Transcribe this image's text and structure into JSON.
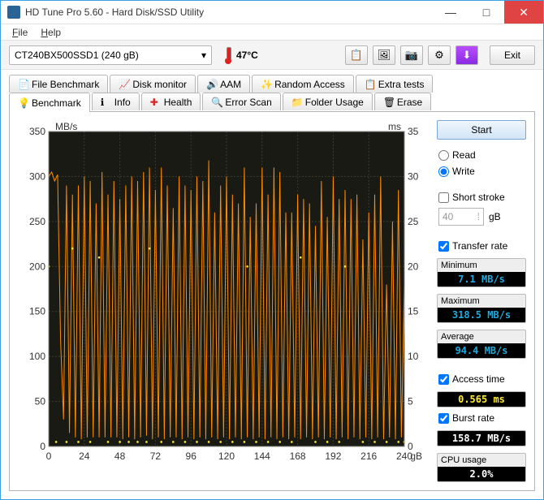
{
  "window": {
    "title": "HD Tune Pro 5.60 - Hard Disk/SSD Utility"
  },
  "menu": {
    "file": "File",
    "help": "Help"
  },
  "toolbar": {
    "drive": "CT240BX500SSD1 (240 gB)",
    "temp": "47°C",
    "exit": "Exit"
  },
  "tabs_top": [
    {
      "label": "File Benchmark"
    },
    {
      "label": "Disk monitor"
    },
    {
      "label": "AAM"
    },
    {
      "label": "Random Access"
    },
    {
      "label": "Extra tests"
    }
  ],
  "tabs_bottom": [
    {
      "label": "Benchmark",
      "active": true
    },
    {
      "label": "Info"
    },
    {
      "label": "Health"
    },
    {
      "label": "Error Scan"
    },
    {
      "label": "Folder Usage"
    },
    {
      "label": "Erase"
    }
  ],
  "side": {
    "start": "Start",
    "read": "Read",
    "write": "Write",
    "short_stroke": "Short stroke",
    "stroke_val": "40",
    "stroke_unit": "gB",
    "transfer_rate": "Transfer rate",
    "minimum_label": "Minimum",
    "minimum_val": "7.1 MB/s",
    "maximum_label": "Maximum",
    "maximum_val": "318.5 MB/s",
    "average_label": "Average",
    "average_val": "94.4 MB/s",
    "access_time": "Access time",
    "access_val": "0.565 ms",
    "burst_rate": "Burst rate",
    "burst_val": "158.7 MB/s",
    "cpu_label": "CPU usage",
    "cpu_val": "2.0%"
  },
  "chart_data": {
    "type": "line",
    "title": "",
    "y_left_label": "MB/s",
    "y_right_label": "ms",
    "xlabel": "gB",
    "x_range": [
      0,
      240
    ],
    "x_ticks": [
      0,
      24,
      48,
      72,
      96,
      120,
      144,
      168,
      192,
      216,
      240
    ],
    "y_left_range": [
      0,
      350
    ],
    "y_left_ticks": [
      0,
      50,
      100,
      150,
      200,
      250,
      300,
      350
    ],
    "y_right_range": [
      0,
      35
    ],
    "y_right_ticks": [
      0,
      5,
      10,
      15,
      20,
      25,
      30,
      35
    ],
    "series": [
      {
        "name": "Transfer rate",
        "axis": "left",
        "color": "#ff8c00",
        "note": "Highly oscillating between ~7 and ~318 MB/s across full range; dense spike pattern",
        "values_sampled": [
          [
            0,
            300
          ],
          [
            2,
            305
          ],
          [
            4,
            295
          ],
          [
            6,
            302
          ],
          [
            8,
            118
          ],
          [
            10,
            30
          ],
          [
            12,
            290
          ],
          [
            14,
            15
          ],
          [
            16,
            280
          ],
          [
            18,
            10
          ],
          [
            20,
            290
          ],
          [
            22,
            8
          ],
          [
            24,
            300
          ],
          [
            26,
            10
          ],
          [
            28,
            295
          ],
          [
            30,
            10
          ],
          [
            32,
            270
          ],
          [
            34,
            10
          ],
          [
            36,
            305
          ],
          [
            38,
            10
          ],
          [
            40,
            280
          ],
          [
            42,
            10
          ],
          [
            44,
            295
          ],
          [
            46,
            10
          ],
          [
            48,
            275
          ],
          [
            50,
            8
          ],
          [
            52,
            290
          ],
          [
            54,
            10
          ],
          [
            56,
            300
          ],
          [
            58,
            8
          ],
          [
            60,
            295
          ],
          [
            62,
            10
          ],
          [
            64,
            305
          ],
          [
            66,
            12
          ],
          [
            68,
            310
          ],
          [
            70,
            8
          ],
          [
            72,
            285
          ],
          [
            74,
            10
          ],
          [
            76,
            310
          ],
          [
            78,
            8
          ],
          [
            80,
            290
          ],
          [
            82,
            10
          ],
          [
            84,
            265
          ],
          [
            86,
            10
          ],
          [
            88,
            300
          ],
          [
            90,
            8
          ],
          [
            92,
            290
          ],
          [
            94,
            10
          ],
          [
            96,
            285
          ],
          [
            98,
            8
          ],
          [
            100,
            300
          ],
          [
            102,
            10
          ],
          [
            104,
            295
          ],
          [
            106,
            8
          ],
          [
            108,
            318
          ],
          [
            110,
            10
          ],
          [
            112,
            260
          ],
          [
            114,
            8
          ],
          [
            116,
            290
          ],
          [
            118,
            10
          ],
          [
            120,
            300
          ],
          [
            122,
            8
          ],
          [
            124,
            280
          ],
          [
            126,
            10
          ],
          [
            128,
            270
          ],
          [
            130,
            8
          ],
          [
            132,
            310
          ],
          [
            134,
            10
          ],
          [
            136,
            255
          ],
          [
            138,
            8
          ],
          [
            140,
            270
          ],
          [
            142,
            10
          ],
          [
            144,
            310
          ],
          [
            146,
            8
          ],
          [
            148,
            280
          ],
          [
            150,
            10
          ],
          [
            152,
            310
          ],
          [
            154,
            8
          ],
          [
            156,
            305
          ],
          [
            158,
            10
          ],
          [
            160,
            260
          ],
          [
            162,
            8
          ],
          [
            164,
            260
          ],
          [
            166,
            10
          ],
          [
            168,
            280
          ],
          [
            170,
            8
          ],
          [
            172,
            275
          ],
          [
            174,
            10
          ],
          [
            176,
            270
          ],
          [
            178,
            8
          ],
          [
            180,
            245
          ],
          [
            182,
            10
          ],
          [
            184,
            295
          ],
          [
            186,
            8
          ],
          [
            188,
            255
          ],
          [
            190,
            10
          ],
          [
            192,
            300
          ],
          [
            194,
            8
          ],
          [
            196,
            275
          ],
          [
            198,
            10
          ],
          [
            200,
            285
          ],
          [
            202,
            8
          ],
          [
            204,
            275
          ],
          [
            206,
            10
          ],
          [
            208,
            280
          ],
          [
            210,
            8
          ],
          [
            212,
            230
          ],
          [
            214,
            10
          ],
          [
            216,
            260
          ],
          [
            218,
            8
          ],
          [
            220,
            280
          ],
          [
            222,
            10
          ],
          [
            224,
            300
          ],
          [
            226,
            8
          ],
          [
            228,
            180
          ],
          [
            230,
            10
          ],
          [
            232,
            250
          ],
          [
            234,
            8
          ],
          [
            236,
            285
          ],
          [
            238,
            10
          ],
          [
            240,
            180
          ]
        ]
      },
      {
        "name": "Access time",
        "axis": "right",
        "color": "#ffeb3b",
        "note": "Scattered low dots mostly near 0-1 ms with occasional spikes around 18-22 ms",
        "values_sampled": [
          [
            0,
            20
          ],
          [
            5,
            0.5
          ],
          [
            12,
            0.5
          ],
          [
            16,
            22
          ],
          [
            20,
            0.5
          ],
          [
            28,
            0.5
          ],
          [
            34,
            21
          ],
          [
            40,
            0.5
          ],
          [
            48,
            0.5
          ],
          [
            54,
            0.5
          ],
          [
            60,
            0.5
          ],
          [
            66,
            0.5
          ],
          [
            68,
            22
          ],
          [
            76,
            0.5
          ],
          [
            84,
            0.5
          ],
          [
            92,
            0.5
          ],
          [
            100,
            0.5
          ],
          [
            108,
            0.5
          ],
          [
            116,
            0.5
          ],
          [
            124,
            0.5
          ],
          [
            132,
            0.5
          ],
          [
            134,
            20
          ],
          [
            140,
            0.5
          ],
          [
            148,
            0.5
          ],
          [
            156,
            0.5
          ],
          [
            164,
            0.5
          ],
          [
            170,
            21
          ],
          [
            180,
            0.5
          ],
          [
            188,
            0.5
          ],
          [
            196,
            0.5
          ],
          [
            200,
            20
          ],
          [
            212,
            0.5
          ],
          [
            220,
            0.5
          ],
          [
            228,
            0.5
          ],
          [
            236,
            0.5
          ],
          [
            240,
            0.5
          ]
        ]
      }
    ]
  }
}
